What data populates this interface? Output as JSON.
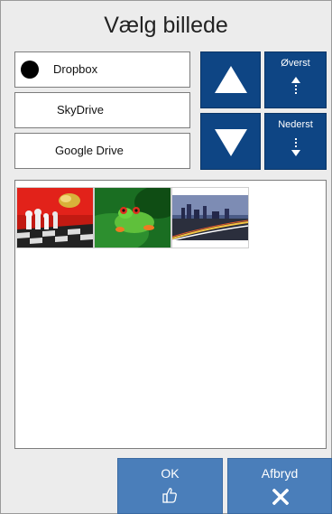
{
  "dialog": {
    "title": "Vælg billede"
  },
  "sources": [
    {
      "label": "Dropbox",
      "selected": true
    },
    {
      "label": "SkyDrive",
      "selected": false
    },
    {
      "label": "Google Drive",
      "selected": false
    }
  ],
  "navigation": {
    "up_icon": "triangle-up-icon",
    "down_icon": "triangle-down-icon",
    "top_label": "Øverst",
    "bottom_label": "Nederst"
  },
  "gallery": {
    "thumbnails": [
      {
        "subject": "chess"
      },
      {
        "subject": "frog"
      },
      {
        "subject": "city-night"
      }
    ]
  },
  "actions": {
    "ok_label": "OK",
    "ok_icon": "thumbs-up-icon",
    "cancel_label": "Afbryd",
    "cancel_icon": "close-icon"
  },
  "colors": {
    "nav_button": "#0e4584",
    "action_button": "#4a7eba",
    "background": "#ececec"
  }
}
